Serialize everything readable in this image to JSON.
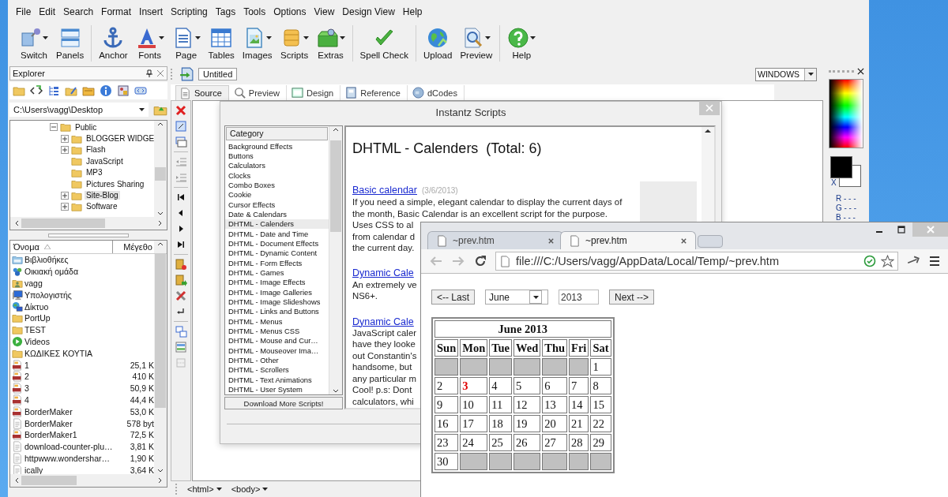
{
  "menu": [
    "File",
    "Edit",
    "Search",
    "Format",
    "Insert",
    "Scripting",
    "Tags",
    "Tools",
    "Options",
    "View",
    "Design View",
    "Help"
  ],
  "toolbar": {
    "groups": [
      [
        {
          "label": "Switch",
          "has_menu": true
        },
        {
          "label": "Panels",
          "has_menu": false
        }
      ],
      [
        {
          "label": "Anchor",
          "has_menu": false
        },
        {
          "label": "Fonts",
          "has_menu": true
        },
        {
          "label": "Page",
          "has_menu": true
        },
        {
          "label": "Tables",
          "has_menu": false
        },
        {
          "label": "Images",
          "has_menu": true
        },
        {
          "label": "Scripts",
          "has_menu": true
        },
        {
          "label": "Extras",
          "has_menu": true
        }
      ],
      [
        {
          "label": "Spell Check",
          "has_menu": false
        }
      ],
      [
        {
          "label": "Upload",
          "has_menu": false
        },
        {
          "label": "Preview",
          "has_menu": true
        }
      ],
      [
        {
          "label": "Help",
          "has_menu": true
        }
      ]
    ]
  },
  "explorer": {
    "title": "Explorer",
    "path": "C:\\Users\\vagg\\Desktop",
    "tree": [
      {
        "label": "Public",
        "kind": "branch",
        "expanded": true,
        "selected": false,
        "children": [
          {
            "label": "BLOGGER WIDGE",
            "kind": "branch",
            "expanded": false,
            "selected": false
          },
          {
            "label": "Flash",
            "kind": "branch",
            "expanded": false,
            "selected": false
          },
          {
            "label": "JavaScript",
            "kind": "leaf",
            "selected": false
          },
          {
            "label": "MP3",
            "kind": "leaf",
            "selected": false
          },
          {
            "label": "Pictures Sharing",
            "kind": "leaf",
            "selected": false
          },
          {
            "label": "Site-Blog",
            "kind": "branch",
            "expanded": false,
            "selected": true
          },
          {
            "label": "Software",
            "kind": "branch",
            "expanded": false,
            "selected": false
          }
        ]
      }
    ],
    "columns": [
      "Όνομα",
      "Μέγεθο"
    ],
    "files": [
      {
        "name": "Βιβλιοθήκες",
        "kind": "library"
      },
      {
        "name": "Οικιακή ομάδα",
        "kind": "homegroup"
      },
      {
        "name": "vagg",
        "kind": "user"
      },
      {
        "name": "Υπολογιστής",
        "kind": "computer"
      },
      {
        "name": "Δίκτυο",
        "kind": "network"
      },
      {
        "name": "PortUp",
        "kind": "folder"
      },
      {
        "name": "TEST",
        "kind": "folder"
      },
      {
        "name": "Videos",
        "kind": "videos"
      },
      {
        "name": "ΚΩΔΙΚΕΣ ΚΟΥΤΙΑ",
        "kind": "folder"
      },
      {
        "name": "1",
        "size": "25,1 K",
        "kind": "png"
      },
      {
        "name": "2",
        "size": "410 K",
        "kind": "png"
      },
      {
        "name": "3",
        "size": "50,9 K",
        "kind": "png"
      },
      {
        "name": "4",
        "size": "44,4 K",
        "kind": "png"
      },
      {
        "name": "BorderMaker",
        "size": "53,0 K",
        "kind": "png"
      },
      {
        "name": "BorderMaker",
        "size": "578 byt",
        "kind": "file"
      },
      {
        "name": "BorderMaker1",
        "size": "72,5 K",
        "kind": "png"
      },
      {
        "name": "download-counter-plu…",
        "size": "3,81 K",
        "kind": "file"
      },
      {
        "name": "httpwww.wondershar…",
        "size": "1,90 K",
        "kind": "file"
      },
      {
        "name": "ically",
        "size": "3,64 K",
        "kind": "file"
      }
    ]
  },
  "editor": {
    "tab": "Untitled",
    "doctype": "WINDOWS",
    "views": [
      {
        "label": "Source",
        "selected": true
      },
      {
        "label": "Preview",
        "selected": false
      },
      {
        "label": "Design",
        "selected": false
      },
      {
        "label": "Reference",
        "selected": false
      },
      {
        "label": "dCodes",
        "selected": false
      }
    ],
    "tag_path": [
      "<html>",
      "<body>"
    ]
  },
  "color_panel": {
    "swap": "X",
    "channels": [
      "R - - -",
      "G - - -",
      "B - - -"
    ]
  },
  "scripts_dialog": {
    "title": "Instantz Scripts",
    "category_header": "Category",
    "categories": [
      {
        "label": "Background Effects",
        "selected": false
      },
      {
        "label": "Buttons",
        "selected": false
      },
      {
        "label": "Calculators",
        "selected": false
      },
      {
        "label": "Clocks",
        "selected": false
      },
      {
        "label": "Combo Boxes",
        "selected": false
      },
      {
        "label": "Cookie",
        "selected": false
      },
      {
        "label": "Cursor Effects",
        "selected": false
      },
      {
        "label": "Date & Calendars",
        "selected": false
      },
      {
        "label": "DHTML - Calenders",
        "selected": true
      },
      {
        "label": "DHTML - Date and Time",
        "selected": false
      },
      {
        "label": "DHTML - Document Effects",
        "selected": false
      },
      {
        "label": "DHTML - Dynamic Content",
        "selected": false
      },
      {
        "label": "DHTML - Form Effects",
        "selected": false
      },
      {
        "label": "DHTML - Games",
        "selected": false
      },
      {
        "label": "DHTML - Image Effects",
        "selected": false
      },
      {
        "label": "DHTML - Image Galleries",
        "selected": false
      },
      {
        "label": "DHTML - Image Slideshows",
        "selected": false
      },
      {
        "label": "DHTML - Links and Buttons",
        "selected": false
      },
      {
        "label": "DHTML - Menus",
        "selected": false
      },
      {
        "label": "DHTML - Menus CSS",
        "selected": false
      },
      {
        "label": "DHTML - Mouse and Cur…",
        "selected": false
      },
      {
        "label": "DHTML - Mouseover Ima…",
        "selected": false
      },
      {
        "label": "DHTML - Other",
        "selected": false
      },
      {
        "label": "DHTML - Scrollers",
        "selected": false
      },
      {
        "label": "DHTML - Text Animations",
        "selected": false
      },
      {
        "label": "DHTML - User System",
        "selected": false
      }
    ],
    "download": "Download More Scripts!",
    "heading": "DHTML - Calenders  (Total: 6)",
    "entries": [
      {
        "title": "Basic calendar",
        "date": "(3/6/2013)",
        "lines": [
          "If you need a simple, elegant calendar to display the current days of",
          "the month, Basic Calendar is an excellent script for the purpose.",
          "Uses CSS to al",
          "from calendar d",
          "the current day."
        ]
      },
      {
        "title": "Dynamic Cale",
        "lines": [
          "An extremely ve",
          "NS6+."
        ]
      },
      {
        "title": "Dynamic Cale",
        "lines": [
          "JavaScript caler",
          "have they looke",
          "out Constantin's",
          "handsome, but",
          "any particular m",
          "Cool! p.s: Dont",
          "calculators, whi"
        ]
      }
    ]
  },
  "browser": {
    "tabs": [
      {
        "title": "~prev.htm",
        "selected": false
      },
      {
        "title": "~prev.htm",
        "selected": true
      }
    ],
    "back_disabled": true,
    "forward_disabled": true,
    "url": "file:///C:/Users/vagg/AppData/Local/Temp/~prev.htm",
    "page": {
      "prev": "<-- Last",
      "month": "June",
      "year": "2013",
      "next": "Next -->",
      "calendar": {
        "title": "June 2013",
        "days": [
          "Sun",
          "Mon",
          "Tue",
          "Wed",
          "Thu",
          "Fri",
          "Sat"
        ],
        "weeks": [
          [
            {
              "kind": "blank"
            },
            {
              "kind": "blank"
            },
            {
              "kind": "blank"
            },
            {
              "kind": "blank"
            },
            {
              "kind": "blank"
            },
            {
              "kind": "blank"
            },
            {
              "kind": "day",
              "text": "1",
              "today": false
            }
          ],
          [
            {
              "kind": "day",
              "text": "2",
              "today": false
            },
            {
              "kind": "day",
              "text": "3",
              "today": true
            },
            {
              "kind": "day",
              "text": "4",
              "today": false
            },
            {
              "kind": "day",
              "text": "5",
              "today": false
            },
            {
              "kind": "day",
              "text": "6",
              "today": false
            },
            {
              "kind": "day",
              "text": "7",
              "today": false
            },
            {
              "kind": "day",
              "text": "8",
              "today": false
            }
          ],
          [
            {
              "kind": "day",
              "text": "9",
              "today": false
            },
            {
              "kind": "day",
              "text": "10",
              "today": false
            },
            {
              "kind": "day",
              "text": "11",
              "today": false
            },
            {
              "kind": "day",
              "text": "12",
              "today": false
            },
            {
              "kind": "day",
              "text": "13",
              "today": false
            },
            {
              "kind": "day",
              "text": "14",
              "today": false
            },
            {
              "kind": "day",
              "text": "15",
              "today": false
            }
          ],
          [
            {
              "kind": "day",
              "text": "16",
              "today": false
            },
            {
              "kind": "day",
              "text": "17",
              "today": false
            },
            {
              "kind": "day",
              "text": "18",
              "today": false
            },
            {
              "kind": "day",
              "text": "19",
              "today": false
            },
            {
              "kind": "day",
              "text": "20",
              "today": false
            },
            {
              "kind": "day",
              "text": "21",
              "today": false
            },
            {
              "kind": "day",
              "text": "22",
              "today": false
            }
          ],
          [
            {
              "kind": "day",
              "text": "23",
              "today": false
            },
            {
              "kind": "day",
              "text": "24",
              "today": false
            },
            {
              "kind": "day",
              "text": "25",
              "today": false
            },
            {
              "kind": "day",
              "text": "26",
              "today": false
            },
            {
              "kind": "day",
              "text": "27",
              "today": false
            },
            {
              "kind": "day",
              "text": "28",
              "today": false
            },
            {
              "kind": "day",
              "text": "29",
              "today": false
            }
          ],
          [
            {
              "kind": "day",
              "text": "30",
              "today": false
            },
            {
              "kind": "blank"
            },
            {
              "kind": "blank"
            },
            {
              "kind": "blank"
            },
            {
              "kind": "blank"
            },
            {
              "kind": "blank"
            },
            {
              "kind": "blank"
            }
          ]
        ]
      }
    }
  }
}
